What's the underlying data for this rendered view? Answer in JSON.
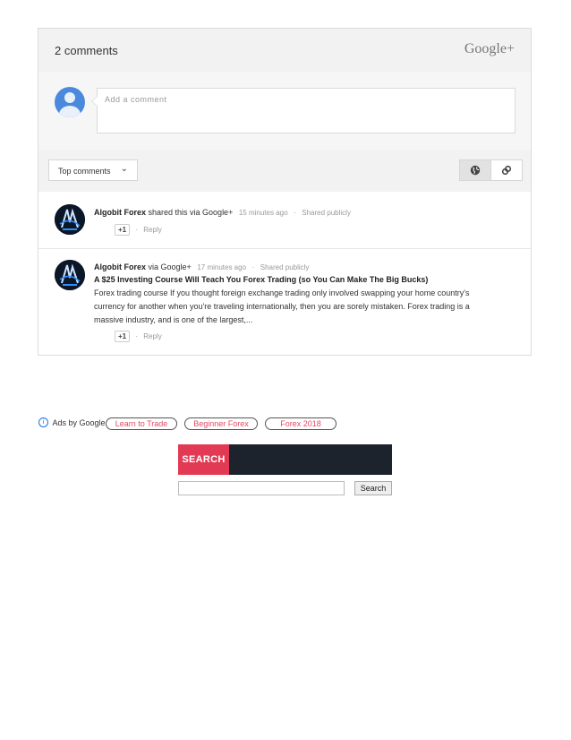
{
  "widget": {
    "count_label": "2 comments",
    "brand": "Google+",
    "add_placeholder": "Add a comment",
    "sort_label": "Top comments",
    "icons": {
      "view_public": "globe-icon",
      "view_link": "link-icon",
      "sort": "chevron-down-icon"
    }
  },
  "comments": [
    {
      "author": "Algobit Forex",
      "action": "shared this via Google+",
      "time": "15 minutes ago",
      "visibility": "Shared publicly",
      "plus_one": "+1",
      "reply": "Reply"
    },
    {
      "author": "Algobit Forex",
      "action": "via Google+",
      "time": "17 minutes ago",
      "visibility": "Shared publicly",
      "title": "A $25 Investing Course Will Teach You Forex Trading (so You Can Make The Big Bucks)",
      "body": "Forex trading course If you thought foreign exchange trading only involved swapping your home country's currency for another when you're traveling internationally, then you are sorely mistaken. Forex trading is a massive industry, and is one of the largest,...",
      "plus_one": "+1",
      "reply": "Reply"
    }
  ],
  "ads": {
    "label": "Ads by Google",
    "info_icon": "info-icon",
    "links": [
      "Learn to Trade",
      "Beginner Forex",
      "Forex 2018"
    ]
  },
  "search": {
    "tab_label": "SEARCH",
    "input_value": "",
    "button_label": "Search"
  },
  "colors": {
    "accent": "#e23a54",
    "dark_bar": "#1c232c",
    "ad_link": "#e04a64",
    "avatar_blue": "#4a89dc"
  }
}
